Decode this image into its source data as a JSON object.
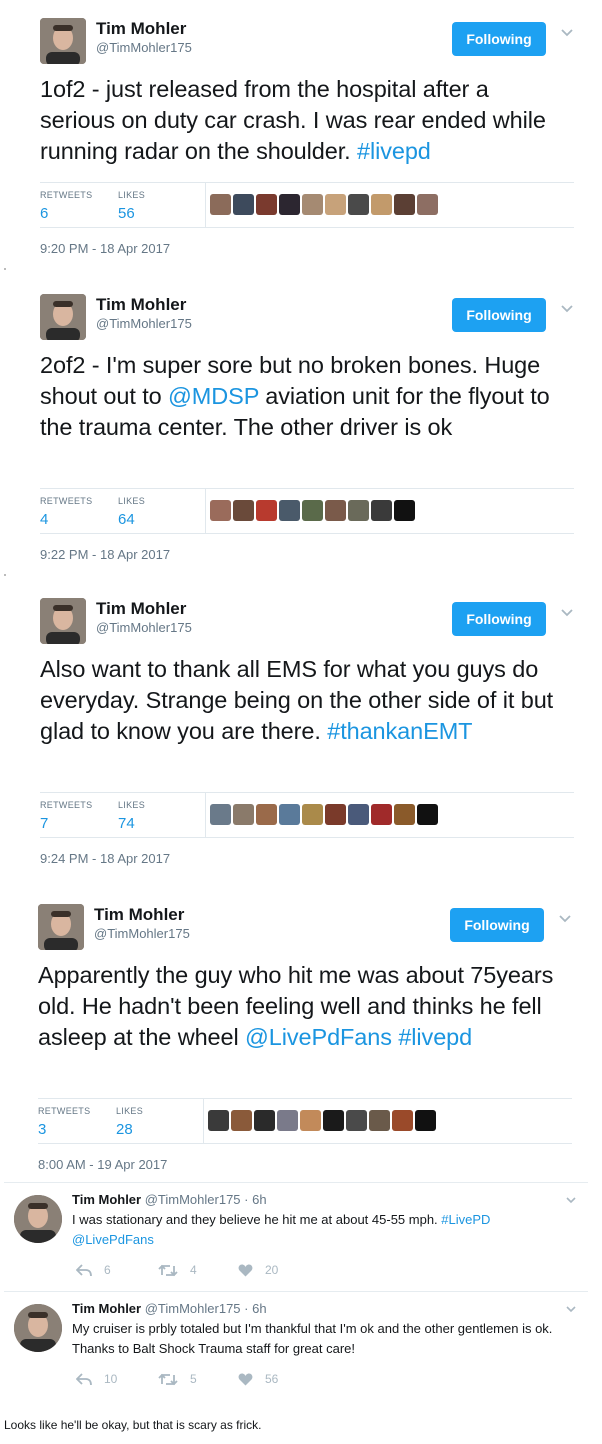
{
  "tweets": [
    {
      "name": "Tim Mohler",
      "handle": "@TimMohler175",
      "follow_label": "Following",
      "text_before": "1of2 - just released from the hospital after a serious on duty car crash. I was rear ended while running radar on the shoulder. ",
      "links": "#livepd",
      "retweets_label": "RETWEETS",
      "retweets": "6",
      "likes_label": "LIKES",
      "likes": "56",
      "time": "9:20 PM - 18 Apr 2017"
    },
    {
      "name": "Tim Mohler",
      "handle": "@TimMohler175",
      "follow_label": "Following",
      "text_before": "2of2 - I'm super sore but no broken bones. Huge shout out to ",
      "links": "@MDSP",
      "text_after": " aviation unit for the flyout to the trauma center. The other driver is ok",
      "retweets_label": "RETWEETS",
      "retweets": "4",
      "likes_label": "LIKES",
      "likes": "64",
      "time": "9:22 PM - 18 Apr 2017"
    },
    {
      "name": "Tim Mohler",
      "handle": "@TimMohler175",
      "follow_label": "Following",
      "text_before": "Also want to thank all EMS for what you guys do everyday. Strange being on the other side of it but glad to know you are there. ",
      "links": "#thankanEMT",
      "retweets_label": "RETWEETS",
      "retweets": "7",
      "likes_label": "LIKES",
      "likes": "74",
      "time": "9:24 PM - 18 Apr 2017"
    },
    {
      "name": "Tim Mohler",
      "handle": "@TimMohler175",
      "follow_label": "Following",
      "text_before": "Apparently the guy who hit me was about 75years old. He hadn't been feeling well and thinks he fell asleep at the wheel ",
      "links": "@LivePdFans #livepd",
      "retweets_label": "RETWEETS",
      "retweets": "3",
      "likes_label": "LIKES",
      "likes": "28",
      "time": "8:00 AM - 19 Apr 2017"
    }
  ],
  "replies": [
    {
      "name": "Tim Mohler",
      "meta": "@TimMohler175 · 6h",
      "text": "I was stationary and they believe he hit me at about 45-55 mph. ",
      "links": "#LivePD @LivePdFans",
      "reply_count": "6",
      "retweet_count": "4",
      "like_count": "20"
    },
    {
      "name": "Tim Mohler",
      "meta": "@TimMohler175 · 6h",
      "text": "My cruiser is prbly totaled but I'm thankful that I'm ok and the other gentlemen is ok. Thanks to Balt Shock Trauma staff for great care!",
      "links": "",
      "reply_count": "10",
      "retweet_count": "5",
      "like_count": "56"
    }
  ],
  "caption": "Looks like he'll be okay, but that is scary as frick.",
  "colors": {
    "accent": "#1da1f2",
    "link": "#1b95e0",
    "muted": "#657786"
  },
  "icons": [
    "chevron-down-icon",
    "reply-icon",
    "retweet-icon",
    "heart-icon"
  ]
}
